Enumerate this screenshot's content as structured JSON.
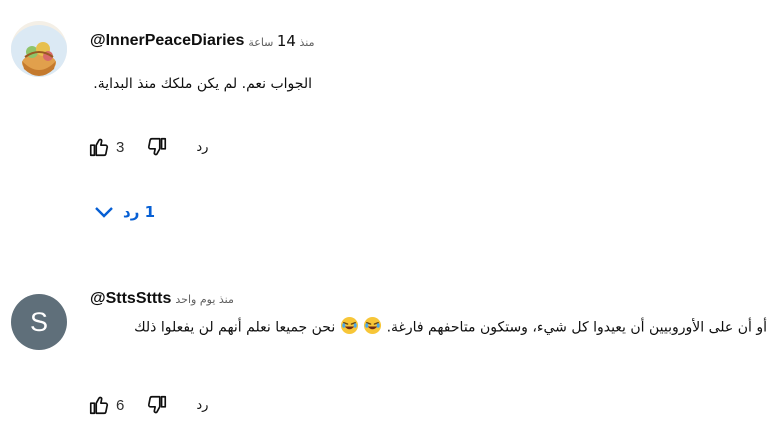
{
  "comments": [
    {
      "handle": "@InnerPeaceDiaries",
      "time_prefix": "منذ",
      "time_num": "14",
      "time_unit": "ساعة",
      "text": "الجواب نعم. لم يكن ملكك منذ البداية.",
      "likes": "3",
      "reply_label": "رد",
      "replies_label": "1 رد"
    },
    {
      "handle": "@SttsSttts",
      "time": "منذ يوم واحد",
      "avatar_letter": "S",
      "text_part1": "أو أن على الأوروبيين أن يعيدوا كل شيء، وستكون متاحفهم فارغة.",
      "text_part2": "نحن جميعا نعلم أنهم لن يفعلوا ذلك",
      "likes": "6",
      "reply_label": "رد"
    }
  ],
  "colors": {
    "link": "#065fd4",
    "avatar_bg": "#5f6f7a",
    "text": "#0f0f0f"
  },
  "icons": [
    "thumbs-up-icon",
    "thumbs-down-icon",
    "chevron-down-icon",
    "laughing-emoji-icon"
  ]
}
